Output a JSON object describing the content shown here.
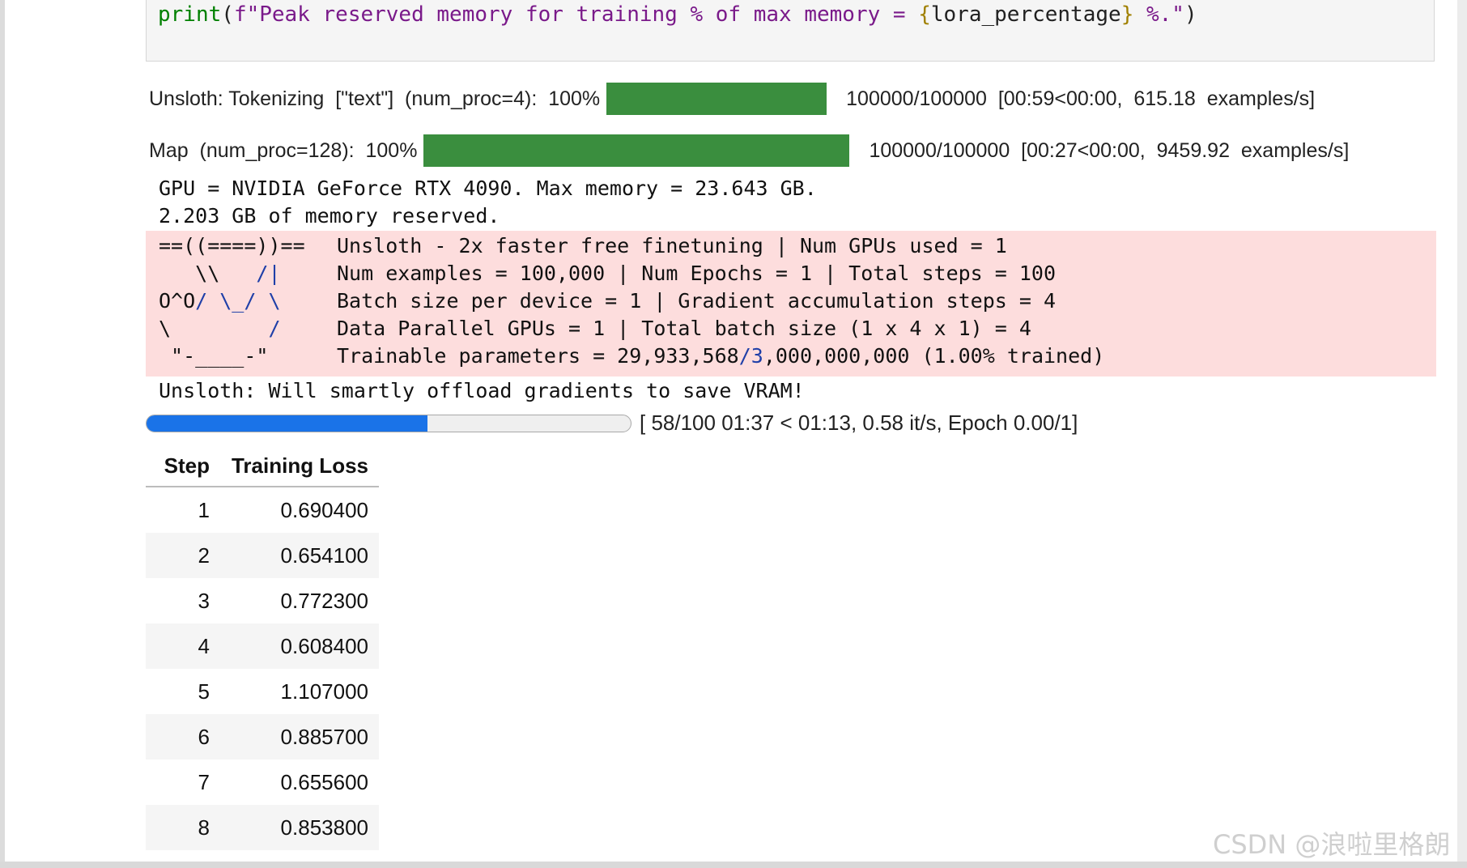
{
  "code_cell": {
    "parts": {
      "func": "print",
      "paren_open": "(",
      "str_start": "f\"Peak reserved memory for training % of max memory = ",
      "brace_open": "{",
      "var": "lora_percentage",
      "brace_close": "}",
      "str_end": " %.\"",
      "paren_close": ")"
    }
  },
  "tokenize_progress": {
    "label": "Unsloth: Tokenizing  [\"text\"]  (num_proc=4):  100%",
    "percent": 100,
    "stats": "100000/100000  [00:59<00:00,  615.18  examples/s]",
    "bar_color": "#3a8e3e"
  },
  "map_progress": {
    "label": "Map  (num_proc=128):  100%",
    "percent": 100,
    "stats": "100000/100000  [00:27<00:00,  9459.92  examples/s]",
    "bar_color": "#3a8e3e"
  },
  "stdout": {
    "gpu_line": "GPU = NVIDIA GeForce RTX 4090. Max memory = 23.643 GB.",
    "reserved_line": "2.203 GB of memory reserved."
  },
  "banner": {
    "art": {
      "row0": "==((====))==",
      "row1_a": "   \\\\   ",
      "row1_b": "/|",
      "row2_a": "O^O",
      "row2_b": "/ \\_/ \\",
      "row3_a": "\\        ",
      "row3_b": "/",
      "row4": " \"-____-\""
    },
    "lines": {
      "row0": "Unsloth - 2x faster free finetuning | Num GPUs used = 1",
      "row1": "Num examples = 100,000 | Num Epochs = 1 | Total steps = 100",
      "row2": "Batch size per device = 1 | Gradient accumulation steps = 4",
      "row3": "Data Parallel GPUs = 1 | Total batch size (1 x 4 x 1) = 4",
      "row4_a": "Trainable parameters = 29,933,568",
      "row4_b": "/3",
      "row4_c": ",000,000,000 (1.00% trained)"
    },
    "background": "#fddddd"
  },
  "offload_message": "Unsloth: Will smartly offload gradients to save VRAM!",
  "training_progress": {
    "current_step": 58,
    "total_steps": 100,
    "label": "[ 58/100 01:37 < 01:13, 0.58 it/s, Epoch 0.00/1]",
    "fill_color": "#1a73e8"
  },
  "loss_table": {
    "headers": [
      "Step",
      "Training Loss"
    ],
    "rows": [
      [
        "1",
        "0.690400"
      ],
      [
        "2",
        "0.654100"
      ],
      [
        "3",
        "0.772300"
      ],
      [
        "4",
        "0.608400"
      ],
      [
        "5",
        "1.107000"
      ],
      [
        "6",
        "0.885700"
      ],
      [
        "7",
        "0.655600"
      ],
      [
        "8",
        "0.853800"
      ]
    ]
  },
  "watermark": "CSDN @浪啦里格朗"
}
